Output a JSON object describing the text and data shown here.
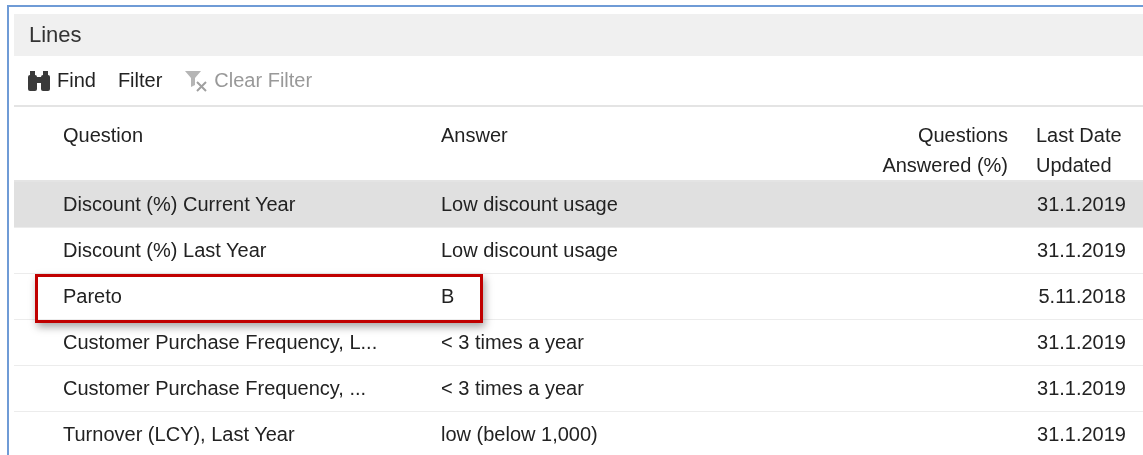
{
  "panel": {
    "title": "Lines"
  },
  "toolbar": [
    {
      "kind": "find",
      "label": "Find",
      "disabled": false
    },
    {
      "kind": "filter",
      "label": "Filter",
      "disabled": false
    },
    {
      "kind": "clear-filter",
      "label": "Clear Filter",
      "disabled": true
    }
  ],
  "table": {
    "columns": [
      "Question",
      "Answer",
      "Questions Answered (%)",
      "Last Date Updated"
    ],
    "rows": [
      {
        "question": "Discount (%) Current Year",
        "answer": "Low discount usage",
        "last_date_updated": "31.1.2019",
        "selected": true,
        "highlighted": false
      },
      {
        "question": "Discount (%) Last Year",
        "answer": "Low discount usage",
        "last_date_updated": "31.1.2019",
        "selected": false,
        "highlighted": false
      },
      {
        "question": "Pareto",
        "answer": "B",
        "last_date_updated": "5.11.2018",
        "selected": false,
        "highlighted": true
      },
      {
        "question": "Customer Purchase Frequency, L...",
        "answer": "< 3 times a year",
        "last_date_updated": "31.1.2019",
        "selected": false,
        "highlighted": false
      },
      {
        "question": "Customer Purchase Frequency, ...",
        "answer": "< 3 times a year",
        "last_date_updated": "31.1.2019",
        "selected": false,
        "highlighted": false
      },
      {
        "question": "Turnover (LCY), Last Year",
        "answer": "low (below 1,000)",
        "last_date_updated": "31.1.2019",
        "selected": false,
        "highlighted": false
      }
    ]
  }
}
